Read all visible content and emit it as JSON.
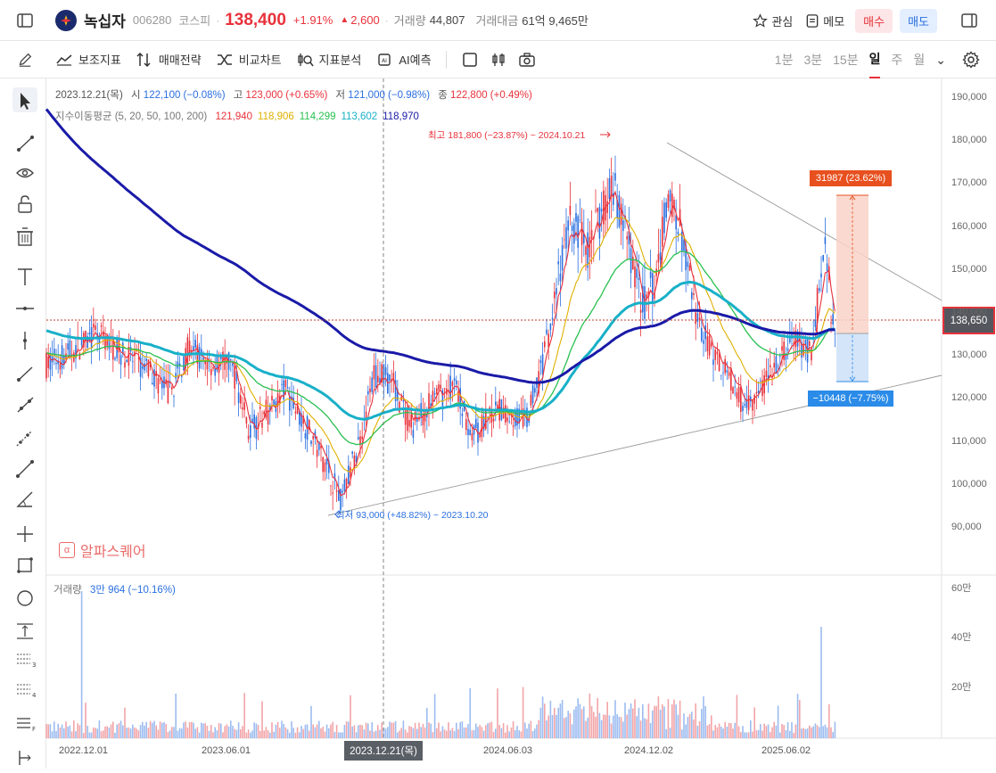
{
  "header": {
    "stock_name": "녹십자",
    "code": "006280",
    "market": "코스피",
    "price": "138,400",
    "change_pct": "+1.91%",
    "change_abs": "2,600",
    "volume_label": "거래량",
    "volume": "44,807",
    "value_label": "거래대금",
    "value": "61억 9,465만",
    "watch_label": "관심",
    "memo_label": "메모",
    "buy_label": "매수",
    "sell_label": "매도"
  },
  "toolbar": {
    "indicators": "보조지표",
    "strategy": "매매전략",
    "compare": "비교차트",
    "analysis": "지표분석",
    "ai": "AI예측",
    "periods": [
      "1분",
      "3분",
      "15분",
      "일",
      "주",
      "월"
    ],
    "active_period": "일"
  },
  "legend": {
    "date": "2023.12.21(목)",
    "open_label": "시",
    "open": "122,100 (−0.08%)",
    "high_label": "고",
    "high": "123,000 (+0.65%)",
    "low_label": "저",
    "low": "121,000 (−0.98%)",
    "close_label": "종",
    "close": "122,800 (+0.49%)",
    "ma_label": "지수이동평균",
    "ma_periods": "(5, 20, 50, 100, 200)",
    "ma_values": [
      "121,940",
      "118,906",
      "114,299",
      "113,602",
      "118,970"
    ],
    "ma_colors": [
      "#e8323b",
      "#e0b000",
      "#28c050",
      "#18b0c8",
      "#1a1aa8"
    ]
  },
  "chart_data": {
    "type": "candlestick",
    "y_axis": [
      "190,000",
      "180,000",
      "170,000",
      "160,000",
      "150,000",
      "140,000",
      "130,000",
      "120,000",
      "110,000",
      "100,000",
      "90,000"
    ],
    "ylim": [
      85000,
      192000
    ],
    "x_axis": [
      "2022.12.01",
      "2023.06.01",
      "2023.12.21(목)",
      "2024.06.03",
      "2024.12.02",
      "2025.06.02"
    ],
    "crosshair_date": "2023.12.21(목)",
    "current_price_label": "138,650",
    "high_annotation": "최고 181,800 (−23.87%) ~ 2024.10.21",
    "low_annotation": "최저 93,000 (+48.82%) ~ 2023.10.20",
    "range_up_label": "31987 (23.62%)",
    "range_down_label": "−10448 (−7.75%)",
    "volume_axis": [
      "60만",
      "40만",
      "20만"
    ],
    "volume_label": "거래량",
    "volume_value": "3만 964 (−10.16%)",
    "watermark": "알파스퀘어",
    "colors": {
      "up": "#e8323b",
      "down": "#2a6fe0"
    }
  }
}
